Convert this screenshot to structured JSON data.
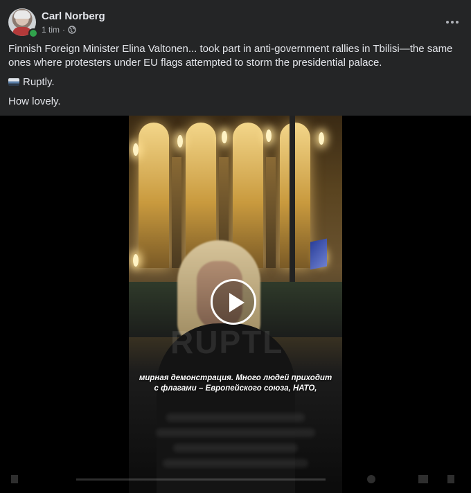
{
  "post": {
    "author": "Carl Norberg",
    "time": "1 tim",
    "separator": "·",
    "paragraphs": [
      "Finnish Foreign Minister Elina Valtonen... took part in anti-government rallies in Tbilisi—the same ones where protesters under EU flags attempted to storm the presidential palace.",
      "Ruptly.",
      "How lovely."
    ]
  },
  "video": {
    "subtitle_line1": "мирная демонстрация. Много людей приходит",
    "subtitle_line2": "с флагами – Европейского союза, НАТО,",
    "watermark": "RUPTL"
  },
  "icons": {
    "audience": "globe-icon",
    "more": "more-options-icon",
    "play": "play-icon",
    "source_emoji": "tv-emoji-icon"
  },
  "colors": {
    "background": "#242526",
    "text": "#e4e6eb",
    "secondary_text": "#b0b3b8",
    "online": "#31a24c"
  }
}
